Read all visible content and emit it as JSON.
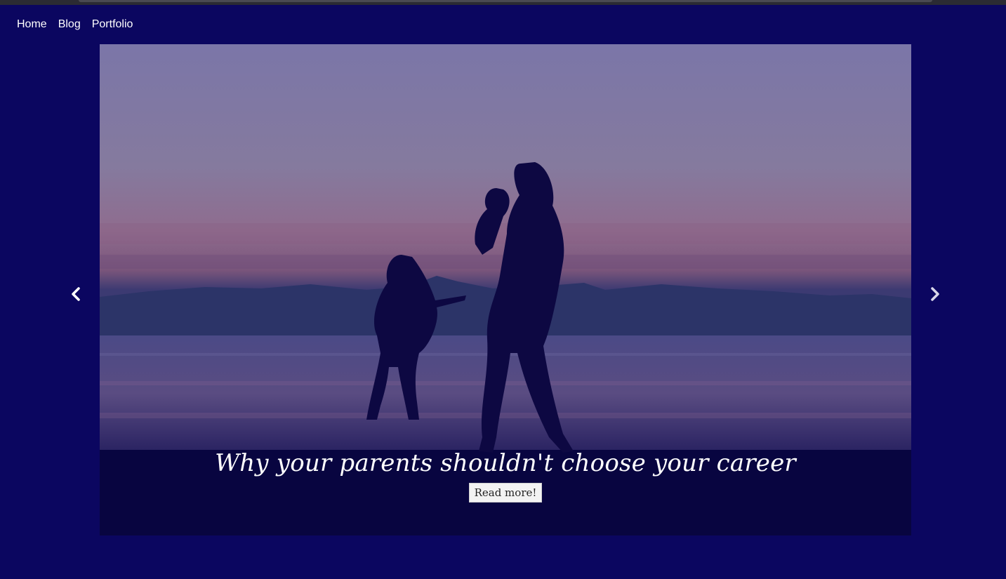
{
  "nav": {
    "items": [
      {
        "label": "Home"
      },
      {
        "label": "Blog"
      },
      {
        "label": "Portfolio"
      }
    ]
  },
  "slide": {
    "title": "Why your parents shouldn't choose your career",
    "button_label": "Read more!"
  },
  "colors": {
    "page_background": "#0b0660",
    "caption_text": "#ffffff",
    "button_background": "#f3f3f3"
  },
  "icons": {
    "prev": "chevron-left-icon",
    "next": "chevron-right-icon"
  }
}
